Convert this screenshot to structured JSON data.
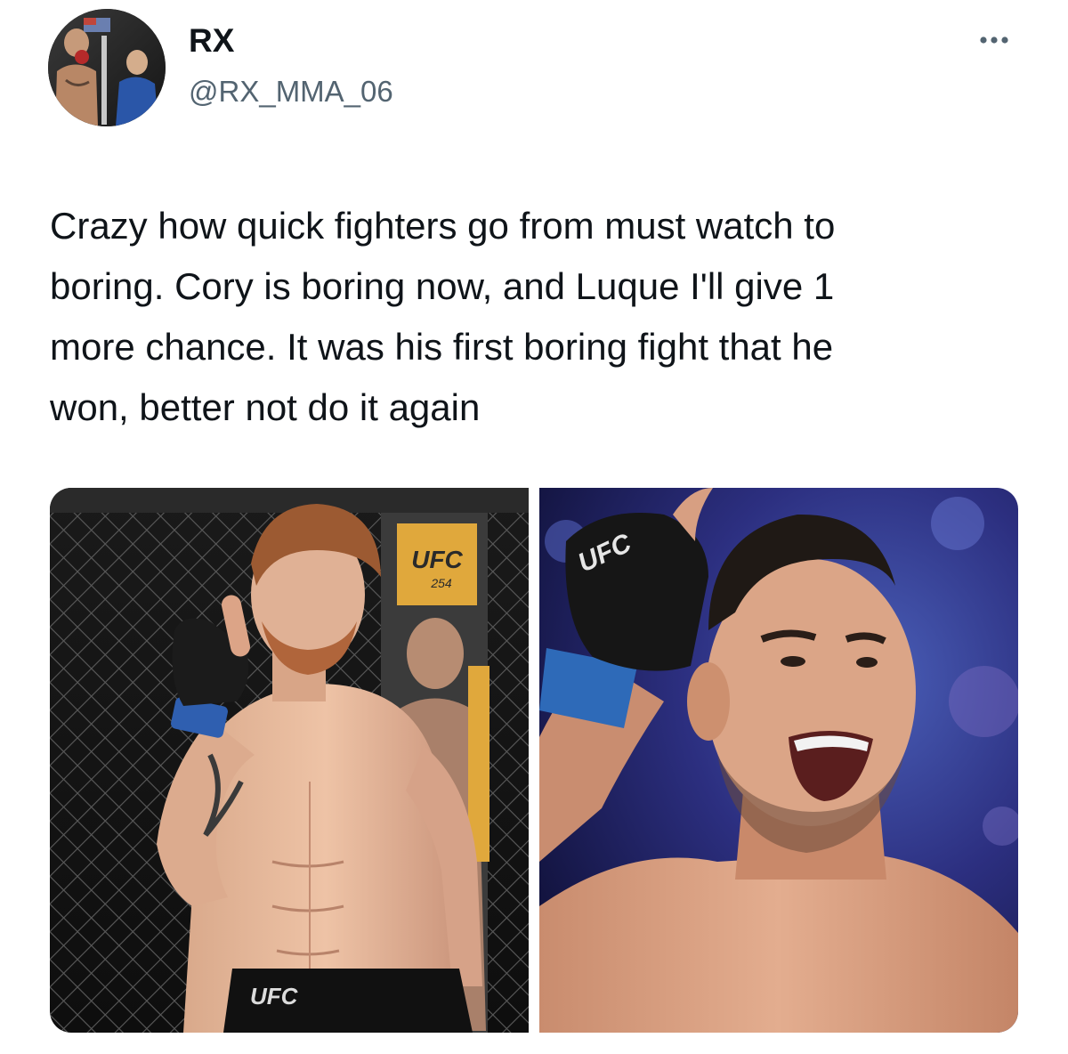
{
  "author": {
    "display_name": "RX",
    "handle": "@RX_MMA_06",
    "avatar_icon": "profile-photo"
  },
  "menu": {
    "more_icon": "more-horizontal-icon"
  },
  "tweet": {
    "text": "Crazy how quick fighters go from must watch to\nboring. Cory is boring now, and Luque I'll give 1\nmore chance. It was his first boring fight that he\nwon, better not do it again"
  },
  "media": {
    "left_photo": {
      "banner_text": "UFC",
      "banner_subtext": "254",
      "shorts_logo": "UFC"
    },
    "right_photo": {
      "glove_logo": "UFC"
    }
  },
  "colors": {
    "text_primary": "#0f1419",
    "text_secondary": "#536471",
    "banner_gold": "#e0a83c"
  }
}
